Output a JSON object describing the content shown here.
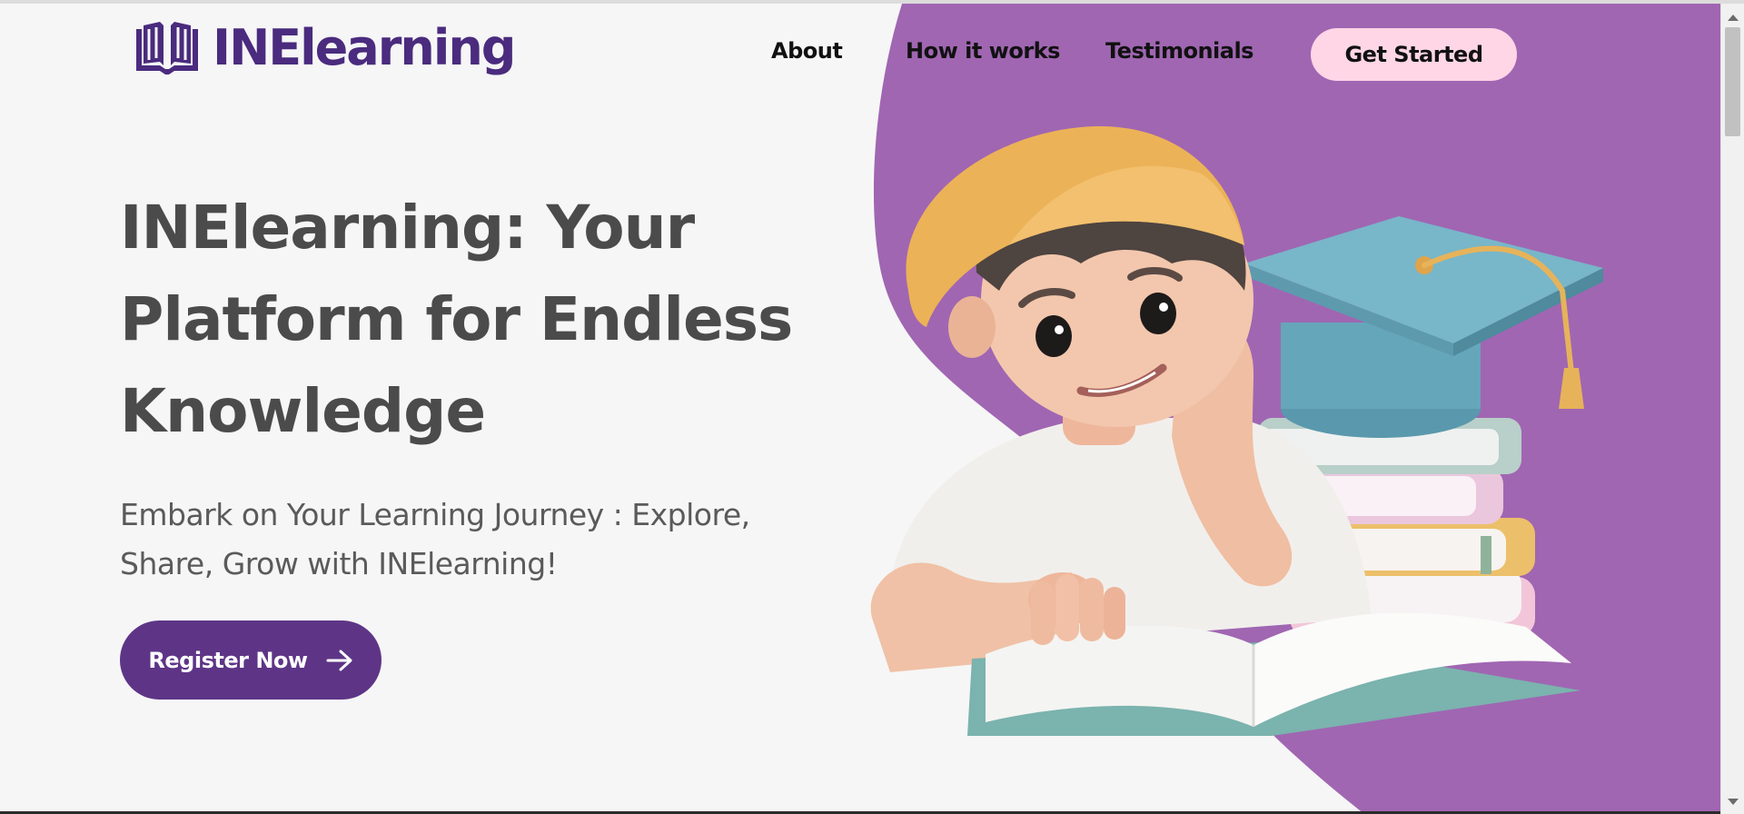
{
  "brand": {
    "name": "INElearning",
    "logo_icon": "book-icon",
    "color": "#4a2b7e"
  },
  "nav": {
    "items": [
      "About",
      "How it works",
      "Testimonials"
    ],
    "cta_label": "Get Started"
  },
  "hero": {
    "title": "INElearning: Your Platform for Endless Knowledge",
    "subtitle": "Embark on Your Learning Journey : Explore, Share, Grow with INElearning!",
    "button_label": "Register Now",
    "button_icon": "arrow-right-icon",
    "illustration": "student-reading-illustration"
  },
  "colors": {
    "accent_purple": "#a066b2",
    "button_purple": "#5e3586",
    "cta_pink": "#ffd6e6",
    "background": "#f6f6f6",
    "heading": "#4b4b4b"
  }
}
